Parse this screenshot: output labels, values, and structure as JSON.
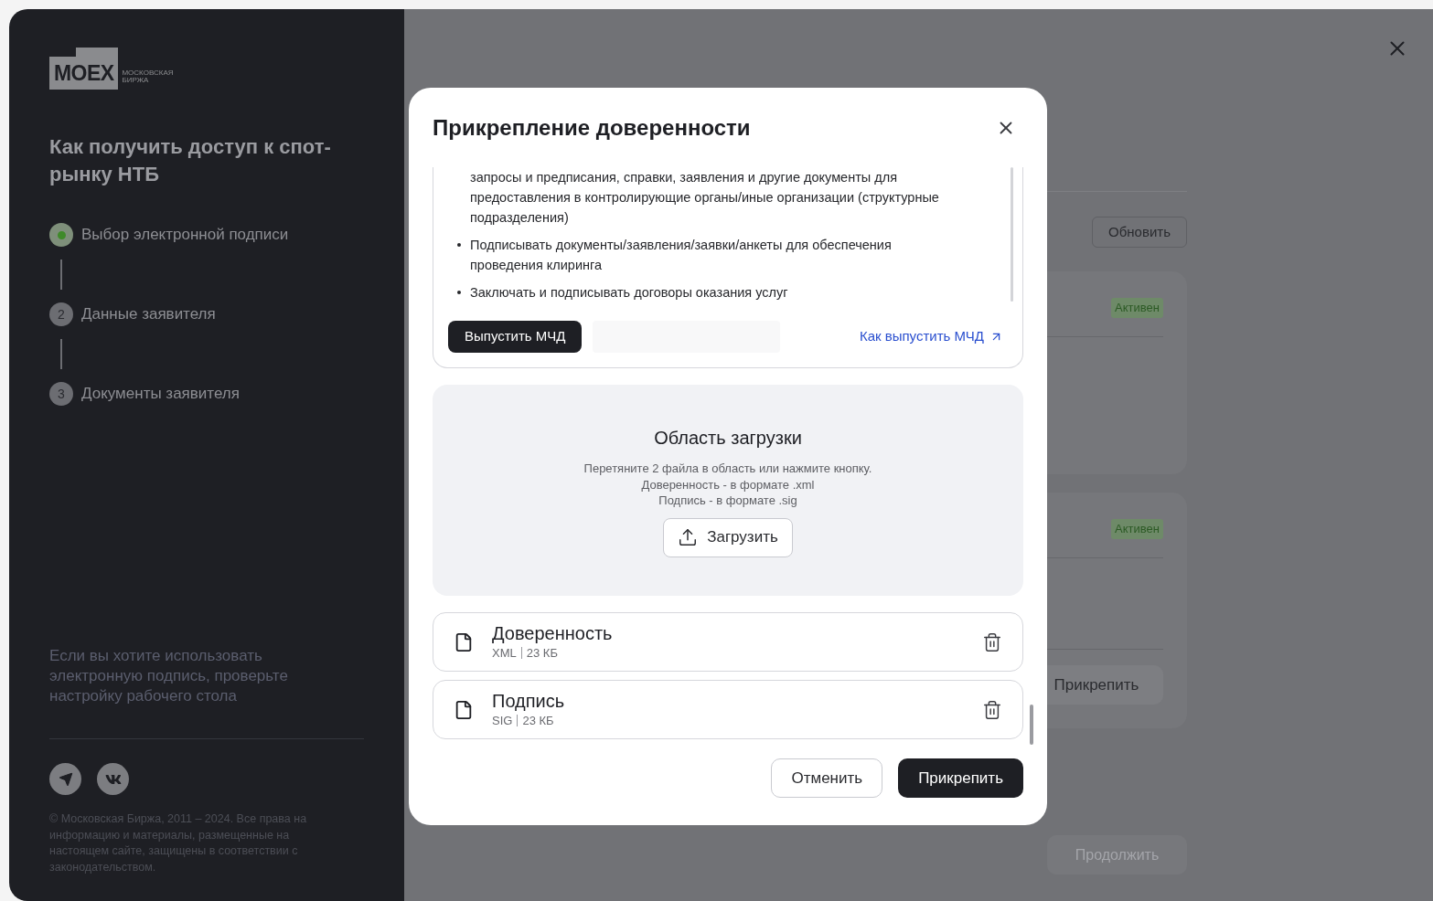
{
  "sidebar": {
    "logo": {
      "mark": "MOEX",
      "caption": [
        "МОСКОВСКАЯ",
        "БИРЖА"
      ]
    },
    "title": "Как получить доступ к спот-рынку НТБ",
    "steps": [
      {
        "label": "Выбор электронной подписи",
        "selected": true
      },
      {
        "number": "2",
        "label": "Данные заявителя",
        "selected": false
      },
      {
        "number": "3",
        "label": "Документы заявителя",
        "selected": false
      }
    ],
    "hint": "Если вы хотите использовать электронную подпись, проверьте настройку рабочего стола",
    "social": [
      {
        "kind": "telegram"
      },
      {
        "kind": "vk"
      }
    ],
    "copyright": "© Московская Биржа, 2011 – 2024. Все права на информацию и материалы, размещенные на настоящем сайте, защищены в соответствии с законодательством."
  },
  "page": {
    "refresh_button": "Обновить",
    "cards": [
      {
        "status": "Активен"
      },
      {
        "status": "Активен",
        "action": "Прикрепить"
      }
    ],
    "continue_button": {
      "label": "Продолжить",
      "disabled": true
    }
  },
  "modal": {
    "title": "Прикрепление доверенности",
    "info": {
      "items": [
        {
          "text": "запросы и предписания, справки, заявления и другие документы для предоставления в контролирующие органы/иные организации (структурные подразделения)",
          "bullet": false
        },
        {
          "text": "Подписывать документы/заявления/заявки/анкеты для обеспечения проведения клиринга",
          "bullet": true
        },
        {
          "text": "Заключать и подписывать договоры оказания услуг",
          "bullet": true
        }
      ],
      "issue_button": "Выпустить МЧД",
      "help_link": "Как выпустить МЧД"
    },
    "upload": {
      "title": "Область загрузки",
      "hint_lines": [
        "Перетяните 2 файла в область или нажмите кнопку.",
        "Доверенность - в формате .xml",
        "Подпись - в формате .sig"
      ],
      "button": "Загрузить"
    },
    "files": [
      {
        "name": "Доверенность",
        "type": "XML",
        "size": "23 КБ"
      },
      {
        "name": "Подпись",
        "type": "SIG",
        "size": "23 КБ"
      }
    ],
    "cancel_button": "Отменить",
    "submit_button": "Прикрепить"
  }
}
